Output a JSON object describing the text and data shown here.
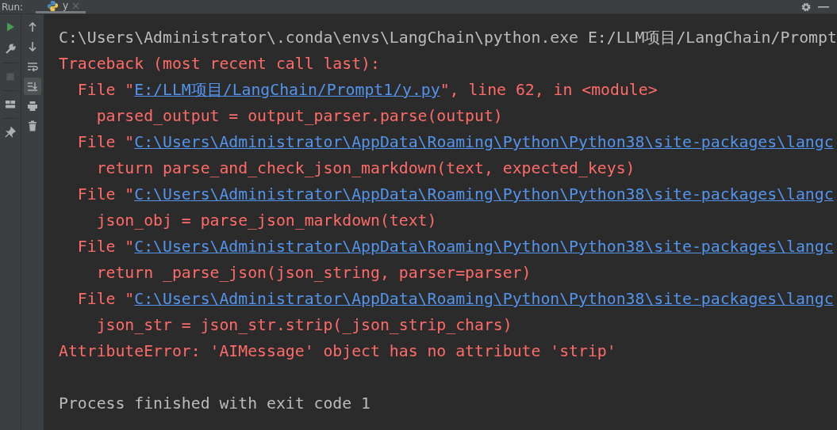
{
  "run_panel": {
    "label": "Run:",
    "tabs": [
      {
        "label": "y",
        "selected": true
      }
    ]
  },
  "left_toolbar": [
    {
      "kind": "run",
      "disabled": false
    },
    {
      "kind": "wrench",
      "disabled": false
    },
    {
      "kind": "stop",
      "disabled": true
    },
    {
      "kind": "layout",
      "disabled": false
    },
    {
      "kind": "pin",
      "disabled": false
    }
  ],
  "side_toolbar": [
    {
      "kind": "up",
      "selected": false
    },
    {
      "kind": "down",
      "selected": false
    },
    {
      "kind": "wrap",
      "selected": false
    },
    {
      "kind": "scroll-end",
      "selected": true
    },
    {
      "kind": "print",
      "selected": false
    },
    {
      "kind": "trash",
      "selected": false
    }
  ],
  "console": [
    {
      "kind": "command",
      "parts": [
        {
          "text": "C:\\Users\\Administrator\\.conda\\envs\\LangChain\\python.exe E:/LLM项目/LangChain/Prompt",
          "link": false
        }
      ]
    },
    {
      "kind": "error",
      "parts": [
        {
          "text": "Traceback (most recent call last):",
          "link": false
        }
      ]
    },
    {
      "kind": "error",
      "parts": [
        {
          "text": "  File \"",
          "link": false
        },
        {
          "text": "E:/LLM项目/LangChain/Prompt1/y.py",
          "link": true
        },
        {
          "text": "\", line 62, in <module>",
          "link": false
        }
      ]
    },
    {
      "kind": "error",
      "parts": [
        {
          "text": "    parsed_output = output_parser.parse(output)",
          "link": false
        }
      ]
    },
    {
      "kind": "error",
      "parts": [
        {
          "text": "  File \"",
          "link": false
        },
        {
          "text": "C:\\Users\\Administrator\\AppData\\Roaming\\Python\\Python38\\site-packages\\langc",
          "link": true
        }
      ]
    },
    {
      "kind": "error",
      "parts": [
        {
          "text": "    return parse_and_check_json_markdown(text, expected_keys)",
          "link": false
        }
      ]
    },
    {
      "kind": "error",
      "parts": [
        {
          "text": "  File \"",
          "link": false
        },
        {
          "text": "C:\\Users\\Administrator\\AppData\\Roaming\\Python\\Python38\\site-packages\\langc",
          "link": true
        }
      ]
    },
    {
      "kind": "error",
      "parts": [
        {
          "text": "    json_obj = parse_json_markdown(text)",
          "link": false
        }
      ]
    },
    {
      "kind": "error",
      "parts": [
        {
          "text": "  File \"",
          "link": false
        },
        {
          "text": "C:\\Users\\Administrator\\AppData\\Roaming\\Python\\Python38\\site-packages\\langc",
          "link": true
        }
      ]
    },
    {
      "kind": "error",
      "parts": [
        {
          "text": "    return _parse_json(json_string, parser=parser)",
          "link": false
        }
      ]
    },
    {
      "kind": "error",
      "parts": [
        {
          "text": "  File \"",
          "link": false
        },
        {
          "text": "C:\\Users\\Administrator\\AppData\\Roaming\\Python\\Python38\\site-packages\\langc",
          "link": true
        }
      ]
    },
    {
      "kind": "error",
      "parts": [
        {
          "text": "    json_str = json_str.strip(_json_strip_chars)",
          "link": false
        }
      ]
    },
    {
      "kind": "error",
      "parts": [
        {
          "text": "AttributeError: 'AIMessage' object has no attribute 'strip'",
          "link": false
        }
      ]
    },
    {
      "kind": "exit",
      "parts": [
        {
          "text": "Process finished with exit code 1",
          "link": false
        }
      ]
    }
  ]
}
